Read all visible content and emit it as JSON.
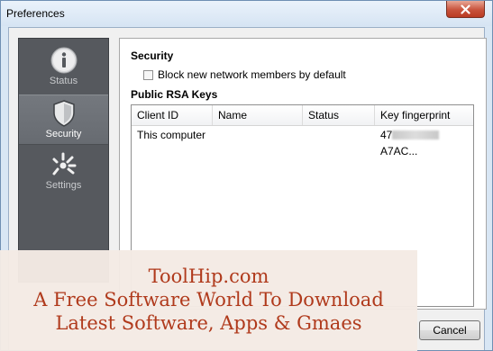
{
  "window": {
    "title": "Preferences"
  },
  "sidebar": {
    "items": [
      {
        "label": "Status",
        "icon": "info-icon",
        "active": false
      },
      {
        "label": "Security",
        "icon": "shield-icon",
        "active": true
      },
      {
        "label": "Settings",
        "icon": "settings-icon",
        "active": false
      }
    ]
  },
  "security": {
    "title": "Security",
    "checkbox_label": "Block new network members by default",
    "checked": false
  },
  "keys": {
    "title": "Public RSA Keys",
    "columns": [
      "Client ID",
      "Name",
      "Status",
      "Key fingerprint"
    ],
    "rows": [
      {
        "client_id": "This computer",
        "name": "",
        "status": "",
        "fingerprint_prefix": "47",
        "fingerprint_suffix": "A7AC..."
      }
    ]
  },
  "buttons": {
    "cancel": "Cancel"
  },
  "watermark": {
    "line1": "ToolHip.com",
    "line2": "A Free Software World To Download",
    "line3": "Latest Software, Apps & Gmaes"
  },
  "colors": {
    "accent_text": "#b03a1c",
    "sidebar_bg": "#56595e",
    "close_button": "#c8533c"
  }
}
